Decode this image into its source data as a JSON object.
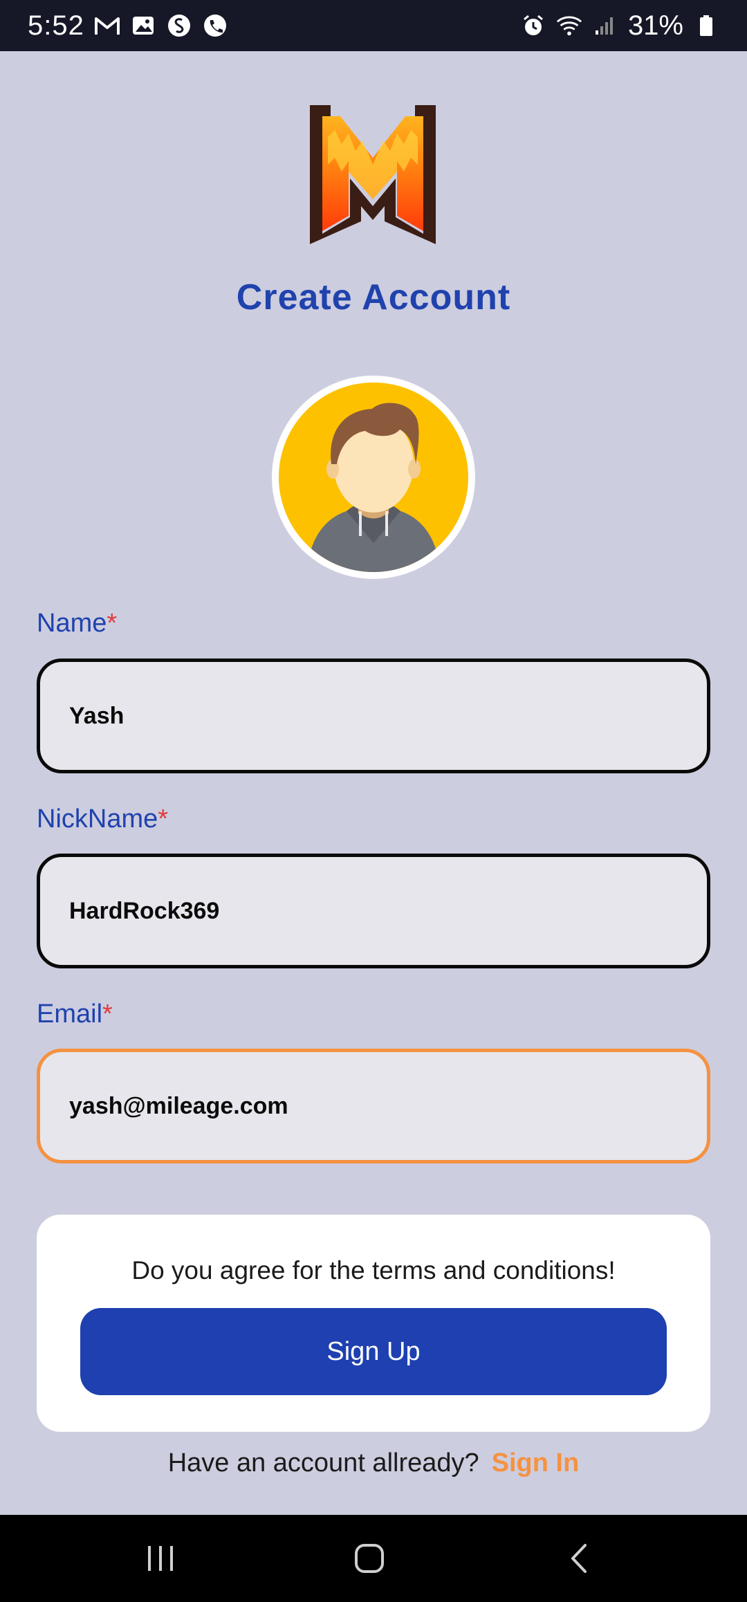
{
  "status_bar": {
    "time": "5:52",
    "battery": "31%",
    "icons_left": [
      "gmail-icon",
      "gallery-icon",
      "shazam-icon",
      "phone-icon"
    ],
    "icons_right": [
      "alarm-icon",
      "wifi-icon",
      "signal-icon",
      "battery-icon"
    ]
  },
  "header": {
    "title": "Create Account",
    "logo": "mileage-logo"
  },
  "form": {
    "name": {
      "label": "Name",
      "required_mark": "*",
      "value": "Yash"
    },
    "nickname": {
      "label": "NickName",
      "required_mark": "*",
      "value": "HardRock369"
    },
    "email": {
      "label": "Email",
      "required_mark": "*",
      "value": "yash@mileage.com"
    }
  },
  "terms": {
    "text": "Do you agree for the terms and conditions!",
    "signup_label": "Sign Up"
  },
  "footer": {
    "prompt": "Have an account allready?",
    "signin_label": "Sign In"
  },
  "colors": {
    "accent": "#1f42ad",
    "button": "#1e40b0",
    "link": "#f5923f",
    "background": "#cdcde0"
  }
}
